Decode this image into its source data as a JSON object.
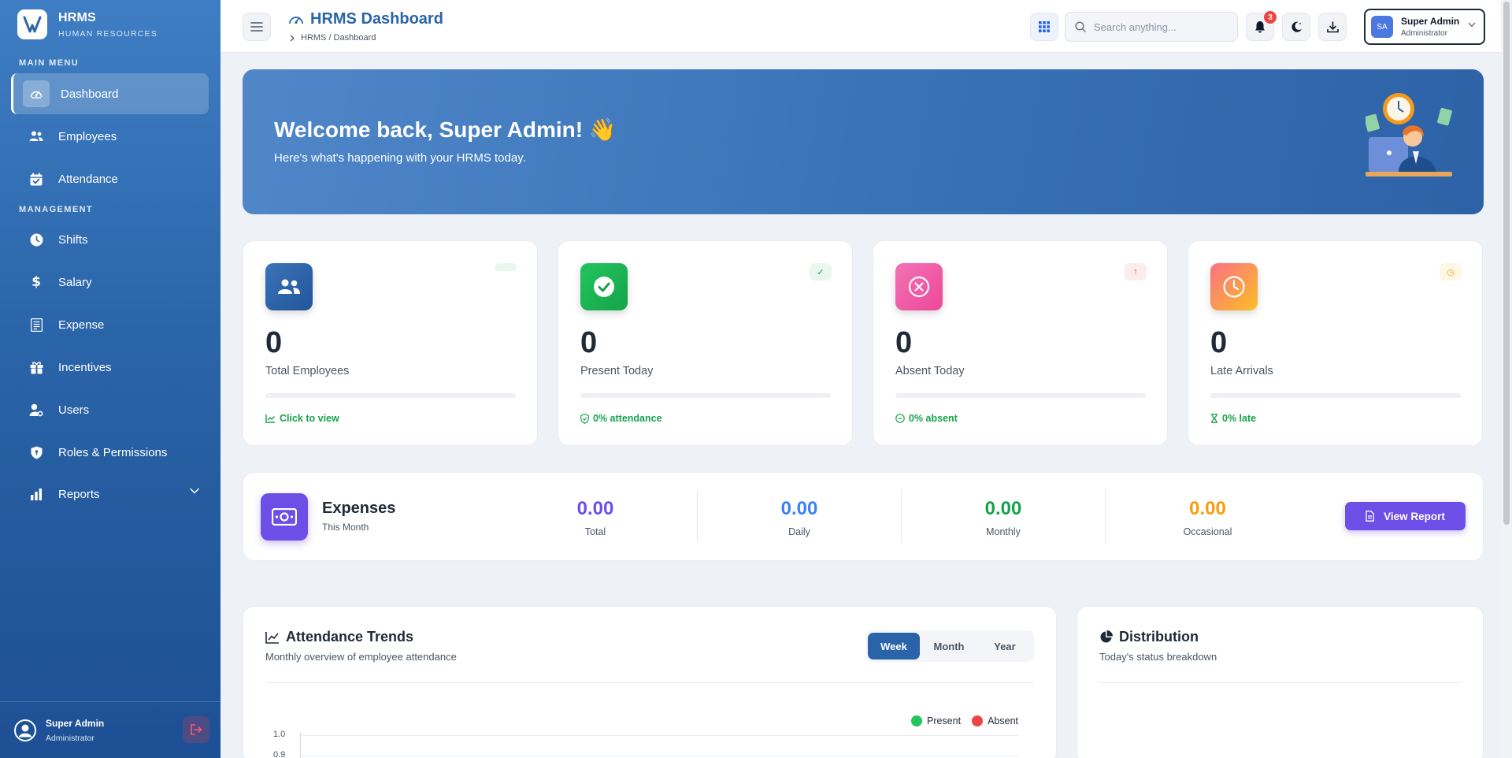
{
  "brand": {
    "name": "HRMS",
    "subtitle": "HUMAN RESOURCES",
    "color": "#2a64a8"
  },
  "sidebar": {
    "sections": [
      {
        "label": "MAIN MENU"
      },
      {
        "label": "MANAGEMENT"
      }
    ],
    "items": [
      {
        "label": "Dashboard",
        "icon": "gauge-icon",
        "active": true
      },
      {
        "label": "Employees",
        "icon": "users-icon"
      },
      {
        "label": "Attendance",
        "icon": "calendar-check-icon"
      },
      {
        "label": "Shifts",
        "icon": "clock-icon"
      },
      {
        "label": "Salary",
        "icon": "dollar-icon"
      },
      {
        "label": "Expense",
        "icon": "receipt-icon"
      },
      {
        "label": "Incentives",
        "icon": "gift-icon"
      },
      {
        "label": "Users",
        "icon": "user-gear-icon"
      },
      {
        "label": "Roles & Permissions",
        "icon": "shield-icon"
      },
      {
        "label": "Reports",
        "icon": "bar-chart-icon",
        "expandable": true
      }
    ],
    "footer": {
      "name": "Super Admin",
      "role": "Administrator"
    }
  },
  "header": {
    "title": "HRMS Dashboard",
    "breadcrumb": "HRMS / Dashboard",
    "search_placeholder": "Search anything...",
    "notification_count": "3",
    "profile": {
      "initials": "SA",
      "name": "Super Admin",
      "role": "Administrator"
    }
  },
  "hero": {
    "title": "Welcome back, Super Admin! 👋",
    "subtitle": "Here's what's happening with your HRMS today."
  },
  "stats": [
    {
      "value": "0",
      "label": "Total Employees",
      "footer": "Click to view",
      "tag": "",
      "accent": "#2a64a8"
    },
    {
      "value": "0",
      "label": "Present Today",
      "footer": "0% attendance",
      "tag": "✓",
      "accent": "#16a34a"
    },
    {
      "value": "0",
      "label": "Absent Today",
      "footer": "0% absent",
      "tag": "↑",
      "accent": "#ec4899"
    },
    {
      "value": "0",
      "label": "Late Arrivals",
      "footer": "0% late",
      "tag": "◷",
      "accent": "#f59e0b"
    }
  ],
  "expenses": {
    "title": "Expenses",
    "subtitle": "This Month",
    "columns": [
      {
        "value": "0.00",
        "label": "Total",
        "color": "#6d4fe8"
      },
      {
        "value": "0.00",
        "label": "Daily",
        "color": "#3b82f6"
      },
      {
        "value": "0.00",
        "label": "Monthly",
        "color": "#16a34a"
      },
      {
        "value": "0.00",
        "label": "Occasional",
        "color": "#f59e0b"
      }
    ],
    "button": "View Report"
  },
  "trends": {
    "title": "Attendance Trends",
    "subtitle": "Monthly overview of employee attendance",
    "tabs": [
      "Week",
      "Month",
      "Year"
    ],
    "active_tab": "Week",
    "legend": [
      {
        "name": "Present",
        "color": "#22c55e"
      },
      {
        "name": "Absent",
        "color": "#ef4444"
      }
    ],
    "y_ticks": [
      "1.0",
      "0.9"
    ]
  },
  "distribution": {
    "title": "Distribution",
    "subtitle": "Today's status breakdown"
  }
}
